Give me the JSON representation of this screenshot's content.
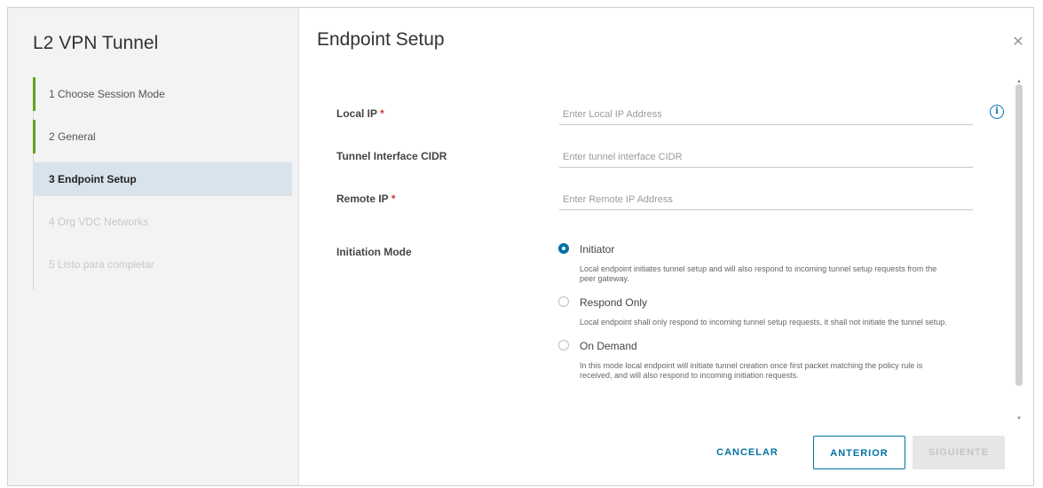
{
  "wizard": {
    "title": "L2 VPN Tunnel",
    "steps": [
      {
        "label": "1  Choose Session Mode",
        "state": "done"
      },
      {
        "label": "2  General",
        "state": "done"
      },
      {
        "label": "3  Endpoint Setup",
        "state": "active"
      },
      {
        "label": "4  Org VDC Networks",
        "state": "disabled"
      },
      {
        "label": "5  Listo para completar",
        "state": "disabled"
      }
    ]
  },
  "main": {
    "title": "Endpoint Setup",
    "close_icon": "close-icon",
    "fields": {
      "local_ip": {
        "label": "Local IP",
        "required_mark": "*",
        "placeholder": "Enter Local IP Address",
        "value": ""
      },
      "tunnel_cidr": {
        "label": "Tunnel Interface CIDR",
        "placeholder": "Enter tunnel interface CIDR",
        "value": ""
      },
      "remote_ip": {
        "label": "Remote IP",
        "required_mark": "*",
        "placeholder": "Enter Remote IP Address",
        "value": ""
      }
    },
    "initiation_mode": {
      "label": "Initiation Mode",
      "options": [
        {
          "label": "Initiator",
          "selected": true,
          "description": "Local endpoint initiates tunnel setup and will also respond to incoming tunnel setup requests from the peer gateway."
        },
        {
          "label": "Respond Only",
          "selected": false,
          "description": "Local endpoint shall only respond to incoming tunnel setup requests, it shall not initiate the tunnel setup."
        },
        {
          "label": "On Demand",
          "selected": false,
          "description": "In this mode local endpoint will initiate tunnel creation once first packet matching the policy rule is received, and will also respond to incoming initiation requests."
        }
      ]
    }
  },
  "footer": {
    "cancel_label": "CANCELAR",
    "prev_label": "ANTERIOR",
    "next_label": "SIGUIENTE"
  },
  "colors": {
    "accent": "#0072a3",
    "done_bar": "#62a420",
    "active_step_bg": "#d8e3ec",
    "required": "#d13b3b"
  }
}
